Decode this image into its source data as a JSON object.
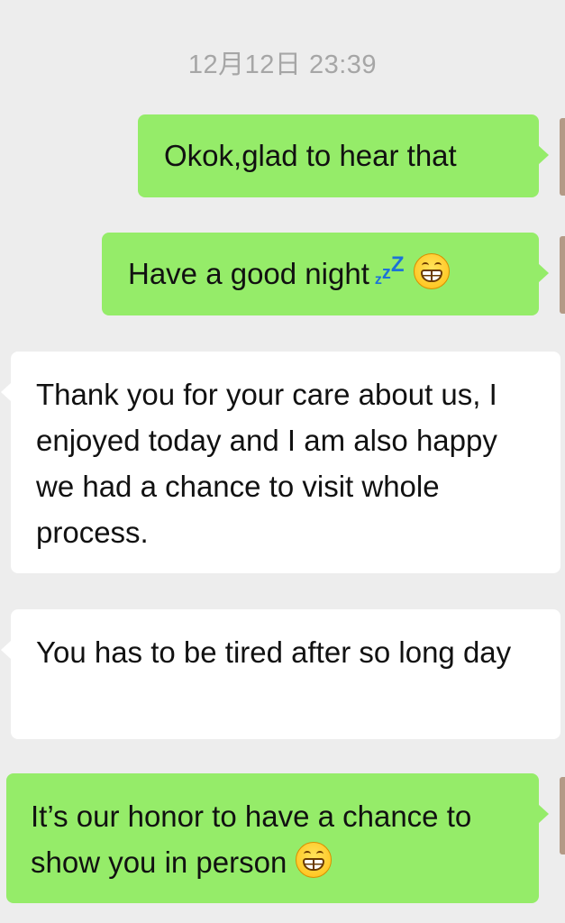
{
  "chat": {
    "timestamp": "12月12日 23:39",
    "messages": [
      {
        "sender": "me",
        "text": "Okok,glad to hear that"
      },
      {
        "sender": "me",
        "text": "Have a good night",
        "emojis": [
          "zzz-icon",
          "grinning-face-icon"
        ]
      },
      {
        "sender": "other",
        "text": "Thank you for your care about us, I enjoyed today and I am also happy we had a chance to visit whole process."
      },
      {
        "sender": "other",
        "text": "You has to be tired after so long day"
      },
      {
        "sender": "me",
        "text": "It’s our honor to have a chance to show you in person",
        "emojis": [
          "grinning-face-icon"
        ]
      }
    ]
  },
  "colors": {
    "background": "#ededed",
    "sent_bubble": "#95ec69",
    "received_bubble": "#ffffff",
    "timestamp_text": "#a6a6a6"
  }
}
